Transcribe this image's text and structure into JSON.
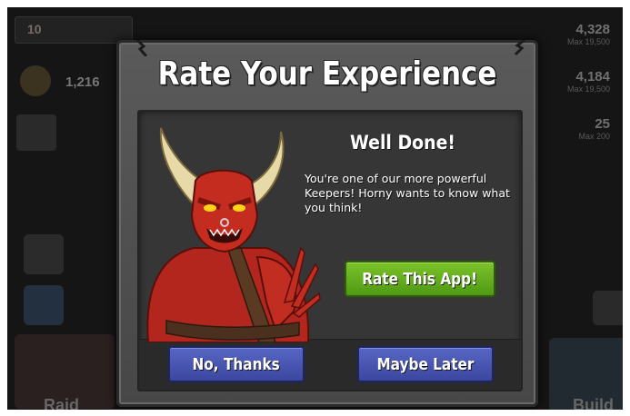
{
  "hud": {
    "level": "10",
    "trophies": "1,216",
    "resources": [
      {
        "value": "4,328",
        "max": "Max 19,500"
      },
      {
        "value": "4,184",
        "max": "Max 19,500"
      },
      {
        "value": "25",
        "max": "Max 200"
      }
    ],
    "raid_label": "Raid",
    "build_label": "Build"
  },
  "dialog": {
    "title": "Rate Your Experience",
    "heading": "Well Done!",
    "message": "You're one of our more powerful Keepers!  Horny wants to know what you think!",
    "rate_button": "Rate This App!",
    "no_button": "No, Thanks",
    "later_button": "Maybe Later"
  },
  "colors": {
    "rate_button": "#5fae1e",
    "secondary_button": "#4654b0",
    "dialog_bg": "#515151"
  },
  "icons": [
    "trophy-icon",
    "play-icon",
    "star-icon",
    "spellbook-icon",
    "upgrade-arrow-icon",
    "horned-demon-character"
  ]
}
